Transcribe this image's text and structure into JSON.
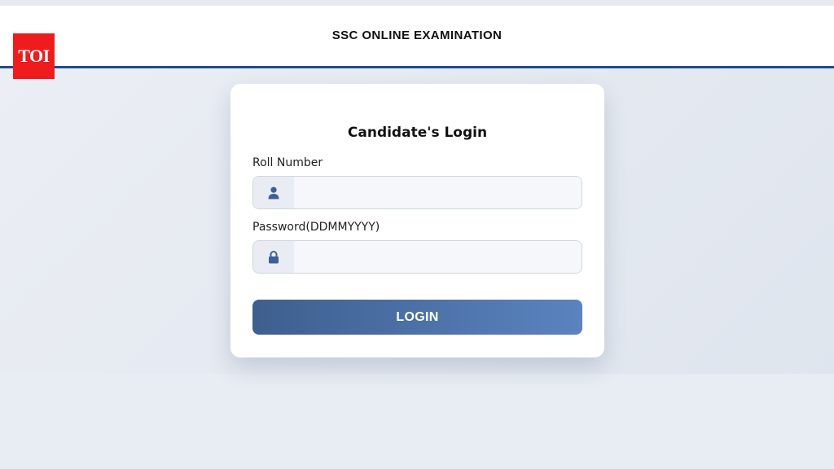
{
  "header": {
    "title": "SSC ONLINE EXAMINATION",
    "logo_text": "TOI"
  },
  "login": {
    "title": "Candidate's Login",
    "roll_label": "Roll Number",
    "roll_value": "",
    "roll_icon": "user-icon",
    "password_label": "Password(DDMMYYYY)",
    "password_value": "",
    "password_icon": "lock-icon",
    "button_label": "LOGIN"
  },
  "colors": {
    "accent": "#1f4a96",
    "button_start": "#3e5f8e",
    "button_end": "#5a83bf",
    "icon": "#3f5f94",
    "logo_bg": "#ee1c1c"
  }
}
